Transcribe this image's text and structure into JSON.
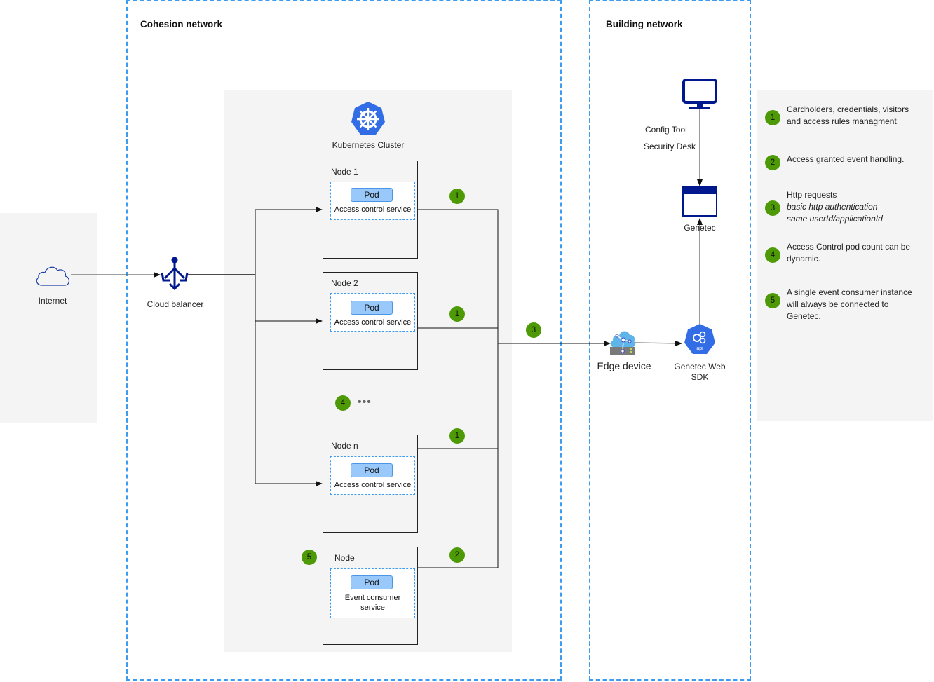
{
  "zones": {
    "cohesion": {
      "title": "Cohesion network"
    },
    "building": {
      "title": "Building network"
    }
  },
  "internet": {
    "label": "Internet",
    "icon": "cloud-icon"
  },
  "cloud_balancer": {
    "label": "Cloud balancer",
    "icon": "load-balancer-icon"
  },
  "cluster": {
    "label": "Kubernetes Cluster",
    "icon": "kubernetes-icon",
    "nodes": [
      {
        "title": "Node 1",
        "pod_label": "Pod",
        "service": "Access control service",
        "badge": "1"
      },
      {
        "title": "Node 2",
        "pod_label": "Pod",
        "service": "Access control service",
        "badge": "1"
      },
      {
        "title": "Node n",
        "pod_label": "Pod",
        "service": "Access control service",
        "badge": "1"
      },
      {
        "title": "Node",
        "pod_label": "Pod",
        "service": "Event consumer service",
        "badge": "2",
        "side_badge": "5"
      }
    ],
    "ellipsis_badge": "4",
    "ellipsis": "•••"
  },
  "connection_badge": "3",
  "building": {
    "workstation": {
      "labels": [
        "Config Tool",
        "Security Desk"
      ],
      "icon": "monitor-icon"
    },
    "genetec": {
      "label": "Genetec",
      "icon": "application-window-icon"
    },
    "edge_device": {
      "label": "Edge device",
      "icon": "edge-device-icon"
    },
    "web_sdk": {
      "label": "Genetec Web SDK",
      "icon": "api-icon"
    }
  },
  "legend": [
    {
      "num": "1",
      "lines": [
        "Cardholders, credentials, visitors",
        "and access rules managment."
      ],
      "italic": [
        false,
        false
      ]
    },
    {
      "num": "2",
      "lines": [
        "Access granted event handling."
      ],
      "italic": [
        false
      ]
    },
    {
      "num": "3",
      "lines": [
        "Http requests",
        "basic http authentication",
        "same userId/applicationId"
      ],
      "italic": [
        false,
        true,
        true
      ]
    },
    {
      "num": "4",
      "lines": [
        "Access Control pod count can be",
        "dynamic."
      ],
      "italic": [
        false,
        false
      ]
    },
    {
      "num": "5",
      "lines": [
        "A single event consumer instance",
        "will always be connected to",
        "Genetec."
      ],
      "italic": [
        false,
        false,
        false
      ]
    }
  ],
  "colors": {
    "zone_border": "#3d9bf0",
    "badge": "#4d9a06",
    "pod_fill": "#99c9fb",
    "icon_navy": "#00188d",
    "k8s_blue": "#326de6"
  }
}
